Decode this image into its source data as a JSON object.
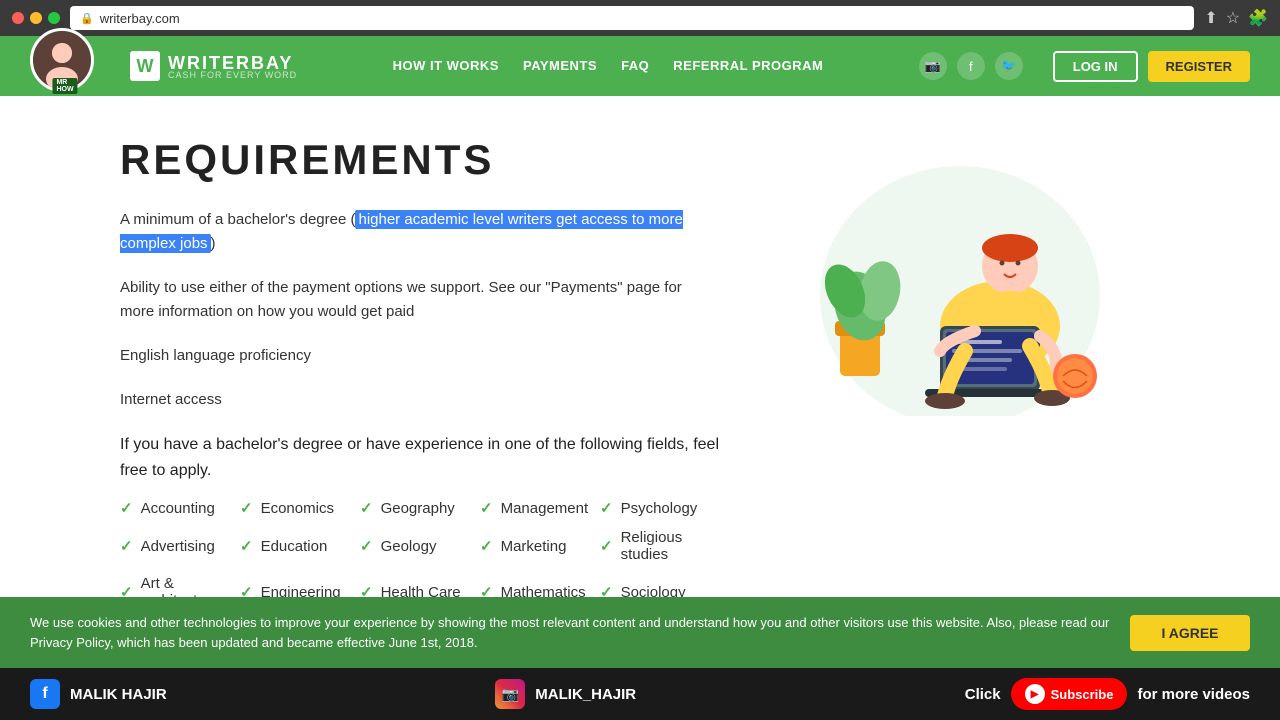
{
  "browser": {
    "url": "writerbay.com",
    "lock_symbol": "🔒"
  },
  "navbar": {
    "logo_letter": "W",
    "logo_name": "WRITERBAY",
    "logo_sub": "CASH FOR EVERY WORD",
    "links": [
      "HOW IT WORKS",
      "PAYMENTS",
      "FAQ",
      "REFERRAL PROGRAM"
    ],
    "btn_login": "LOG IN",
    "btn_register": "REGISTER"
  },
  "page": {
    "title": "REQUIREMENTS",
    "para1_start": "A minimum of a bachelor's degree (",
    "para1_highlight": "higher academic level writers get access to more complex jobs",
    "para1_end": ")",
    "para2": "Ability to use either of the payment options we support. See our \"Payments\" page for more information on how you would get paid",
    "para3": "English language proficiency",
    "para4": "Internet access",
    "fields_intro": "If you have a bachelor's degree or have experience in one of the following fields, feel free to apply.",
    "fields": [
      [
        "Accounting",
        "Economics",
        "Geography",
        "Management",
        "Psychology"
      ],
      [
        "Advertising",
        "Education",
        "Geology",
        "Marketing",
        "Religious studies"
      ],
      [
        "Art & architecture",
        "Engineering",
        "Health Care",
        "Mathematics",
        "Sociology"
      ]
    ]
  },
  "cookie": {
    "text": "We use cookies and other technologies to improve your experience by showing the most relevant content and understand how you and other visitors use this website. Also, please read our Privacy Policy, which has been updated and became effective June 1st, 2018.",
    "btn": "I AGREE"
  },
  "bottom_bar": {
    "fb_name": "MALIK HAJIR",
    "ig_name": "MALIK_HAJIR",
    "subscribe_text": "Click",
    "subscribe_btn": "Subscribe",
    "end_text": "for more videos"
  }
}
